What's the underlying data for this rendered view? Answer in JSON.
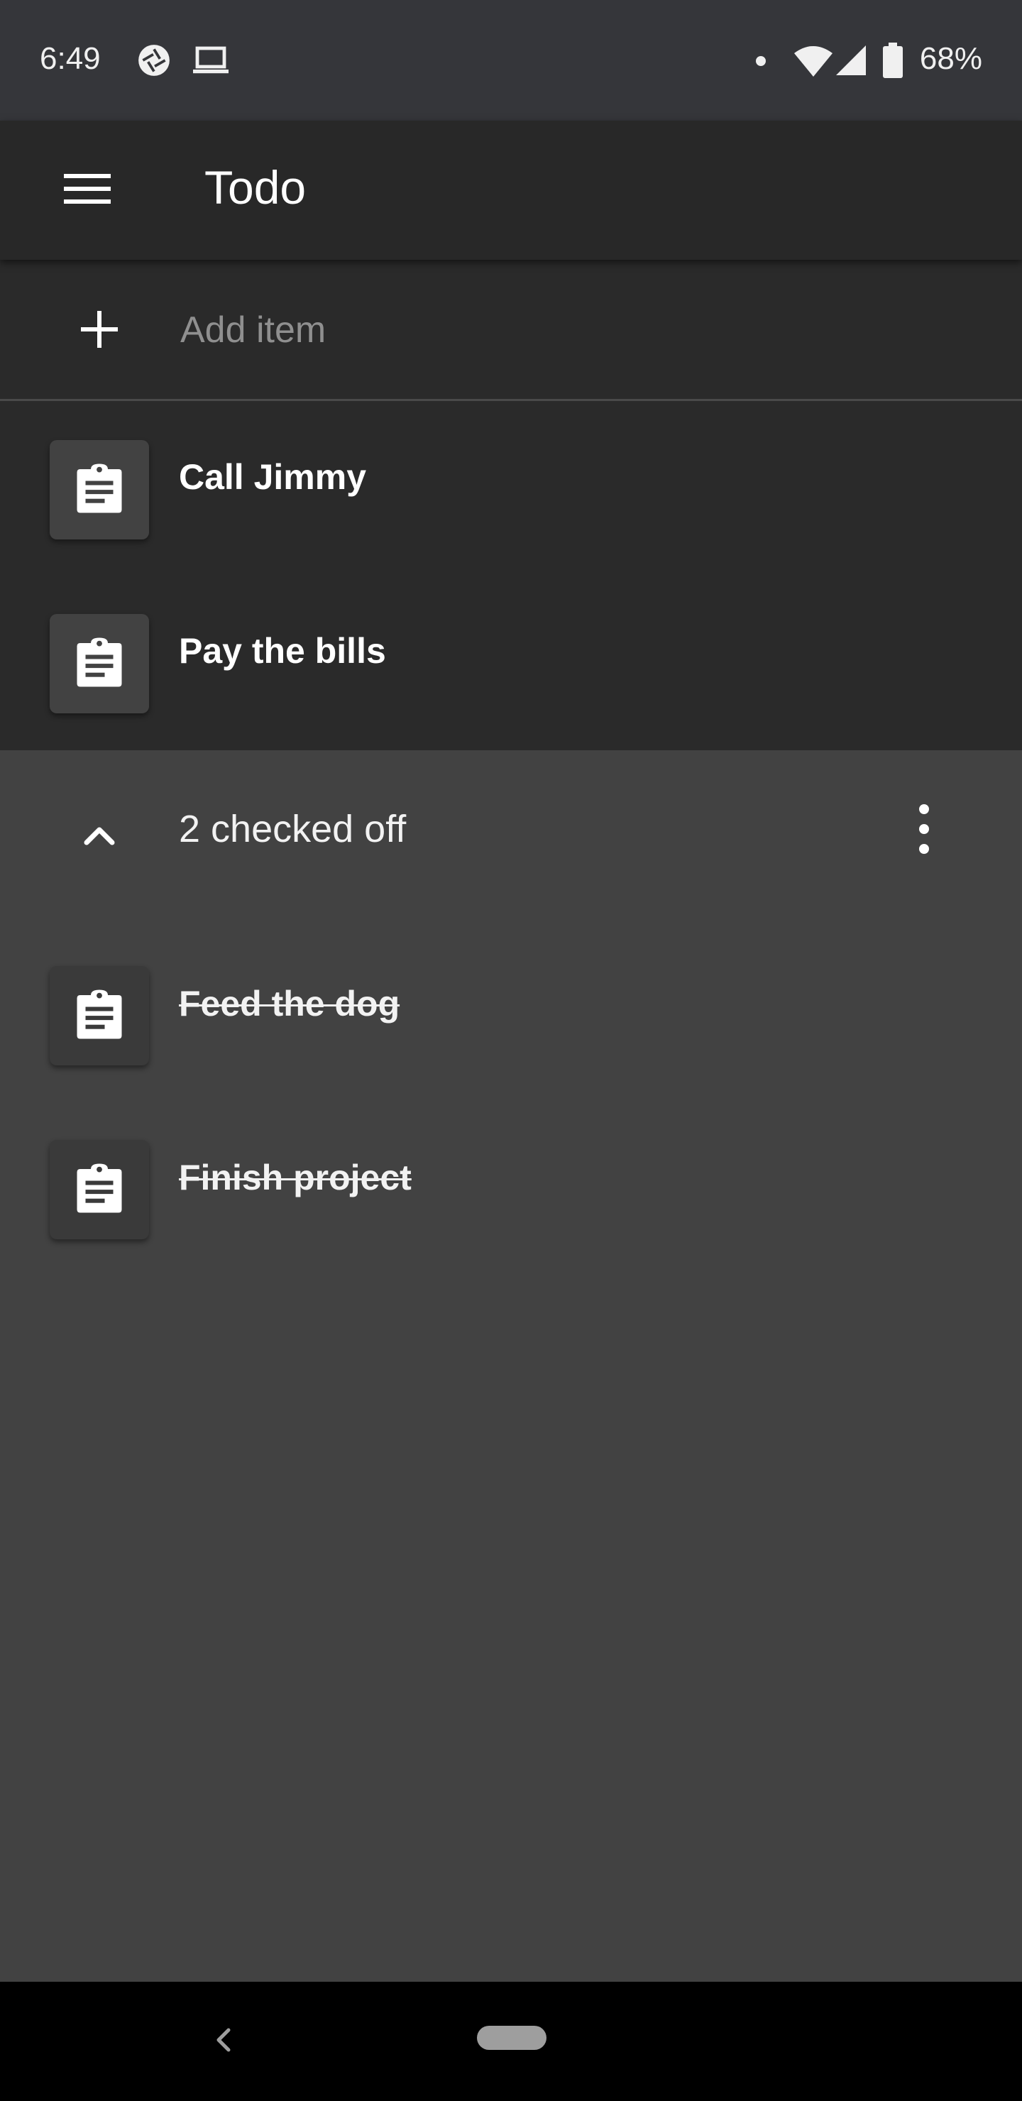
{
  "status_bar": {
    "time": "6:49",
    "battery": "68%",
    "icons": [
      "camera-aperture-icon",
      "laptop-icon",
      "notification-dot-icon",
      "wifi-icon",
      "cell-signal-icon",
      "battery-icon"
    ]
  },
  "app_bar": {
    "title": "Todo",
    "menu_icon": "menu-icon"
  },
  "add_item": {
    "placeholder": "Add item",
    "icon": "plus-icon"
  },
  "active_items": [
    {
      "label": "Call Jimmy",
      "icon": "clipboard-icon",
      "checked": false
    },
    {
      "label": "Pay the bills",
      "icon": "clipboard-icon",
      "checked": false
    }
  ],
  "checked_section": {
    "label": "2 checked off",
    "expanded": true,
    "collapse_icon": "chevron-up-icon",
    "menu_icon": "more-vert-icon"
  },
  "checked_items": [
    {
      "label": "Feed the dog",
      "icon": "clipboard-icon",
      "checked": true
    },
    {
      "label": "Finish project",
      "icon": "clipboard-icon",
      "checked": true
    }
  ],
  "nav_bar": {
    "back_icon": "back-chevron-icon",
    "home_icon": "home-pill-icon"
  },
  "colors": {
    "status_bar_bg": "#35363a",
    "app_bar_bg": "#282828",
    "active_list_bg": "#2a2a2a",
    "checked_bg": "#424242",
    "nav_bar_bg": "#000000"
  }
}
